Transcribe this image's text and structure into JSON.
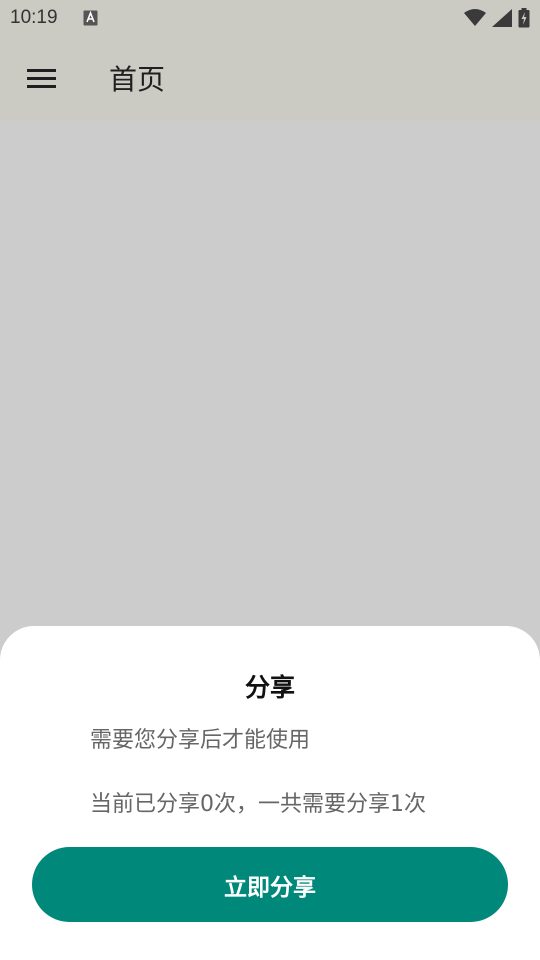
{
  "status_bar": {
    "time": "10:19",
    "notification_icon": "a-notification-icon",
    "icons": [
      "wifi-icon",
      "signal-icon",
      "battery-charging-icon"
    ]
  },
  "app_bar": {
    "menu_icon": "hamburger-menu-icon",
    "title": "首页",
    "background": "#cbcbc4"
  },
  "content": {
    "background": "#cccccc"
  },
  "share_sheet": {
    "title": "分享",
    "message": "需要您分享后才能使用",
    "count_text": "当前已分享0次，一共需要分享1次",
    "button_label": "立即分享",
    "button_color": "#00897a"
  }
}
